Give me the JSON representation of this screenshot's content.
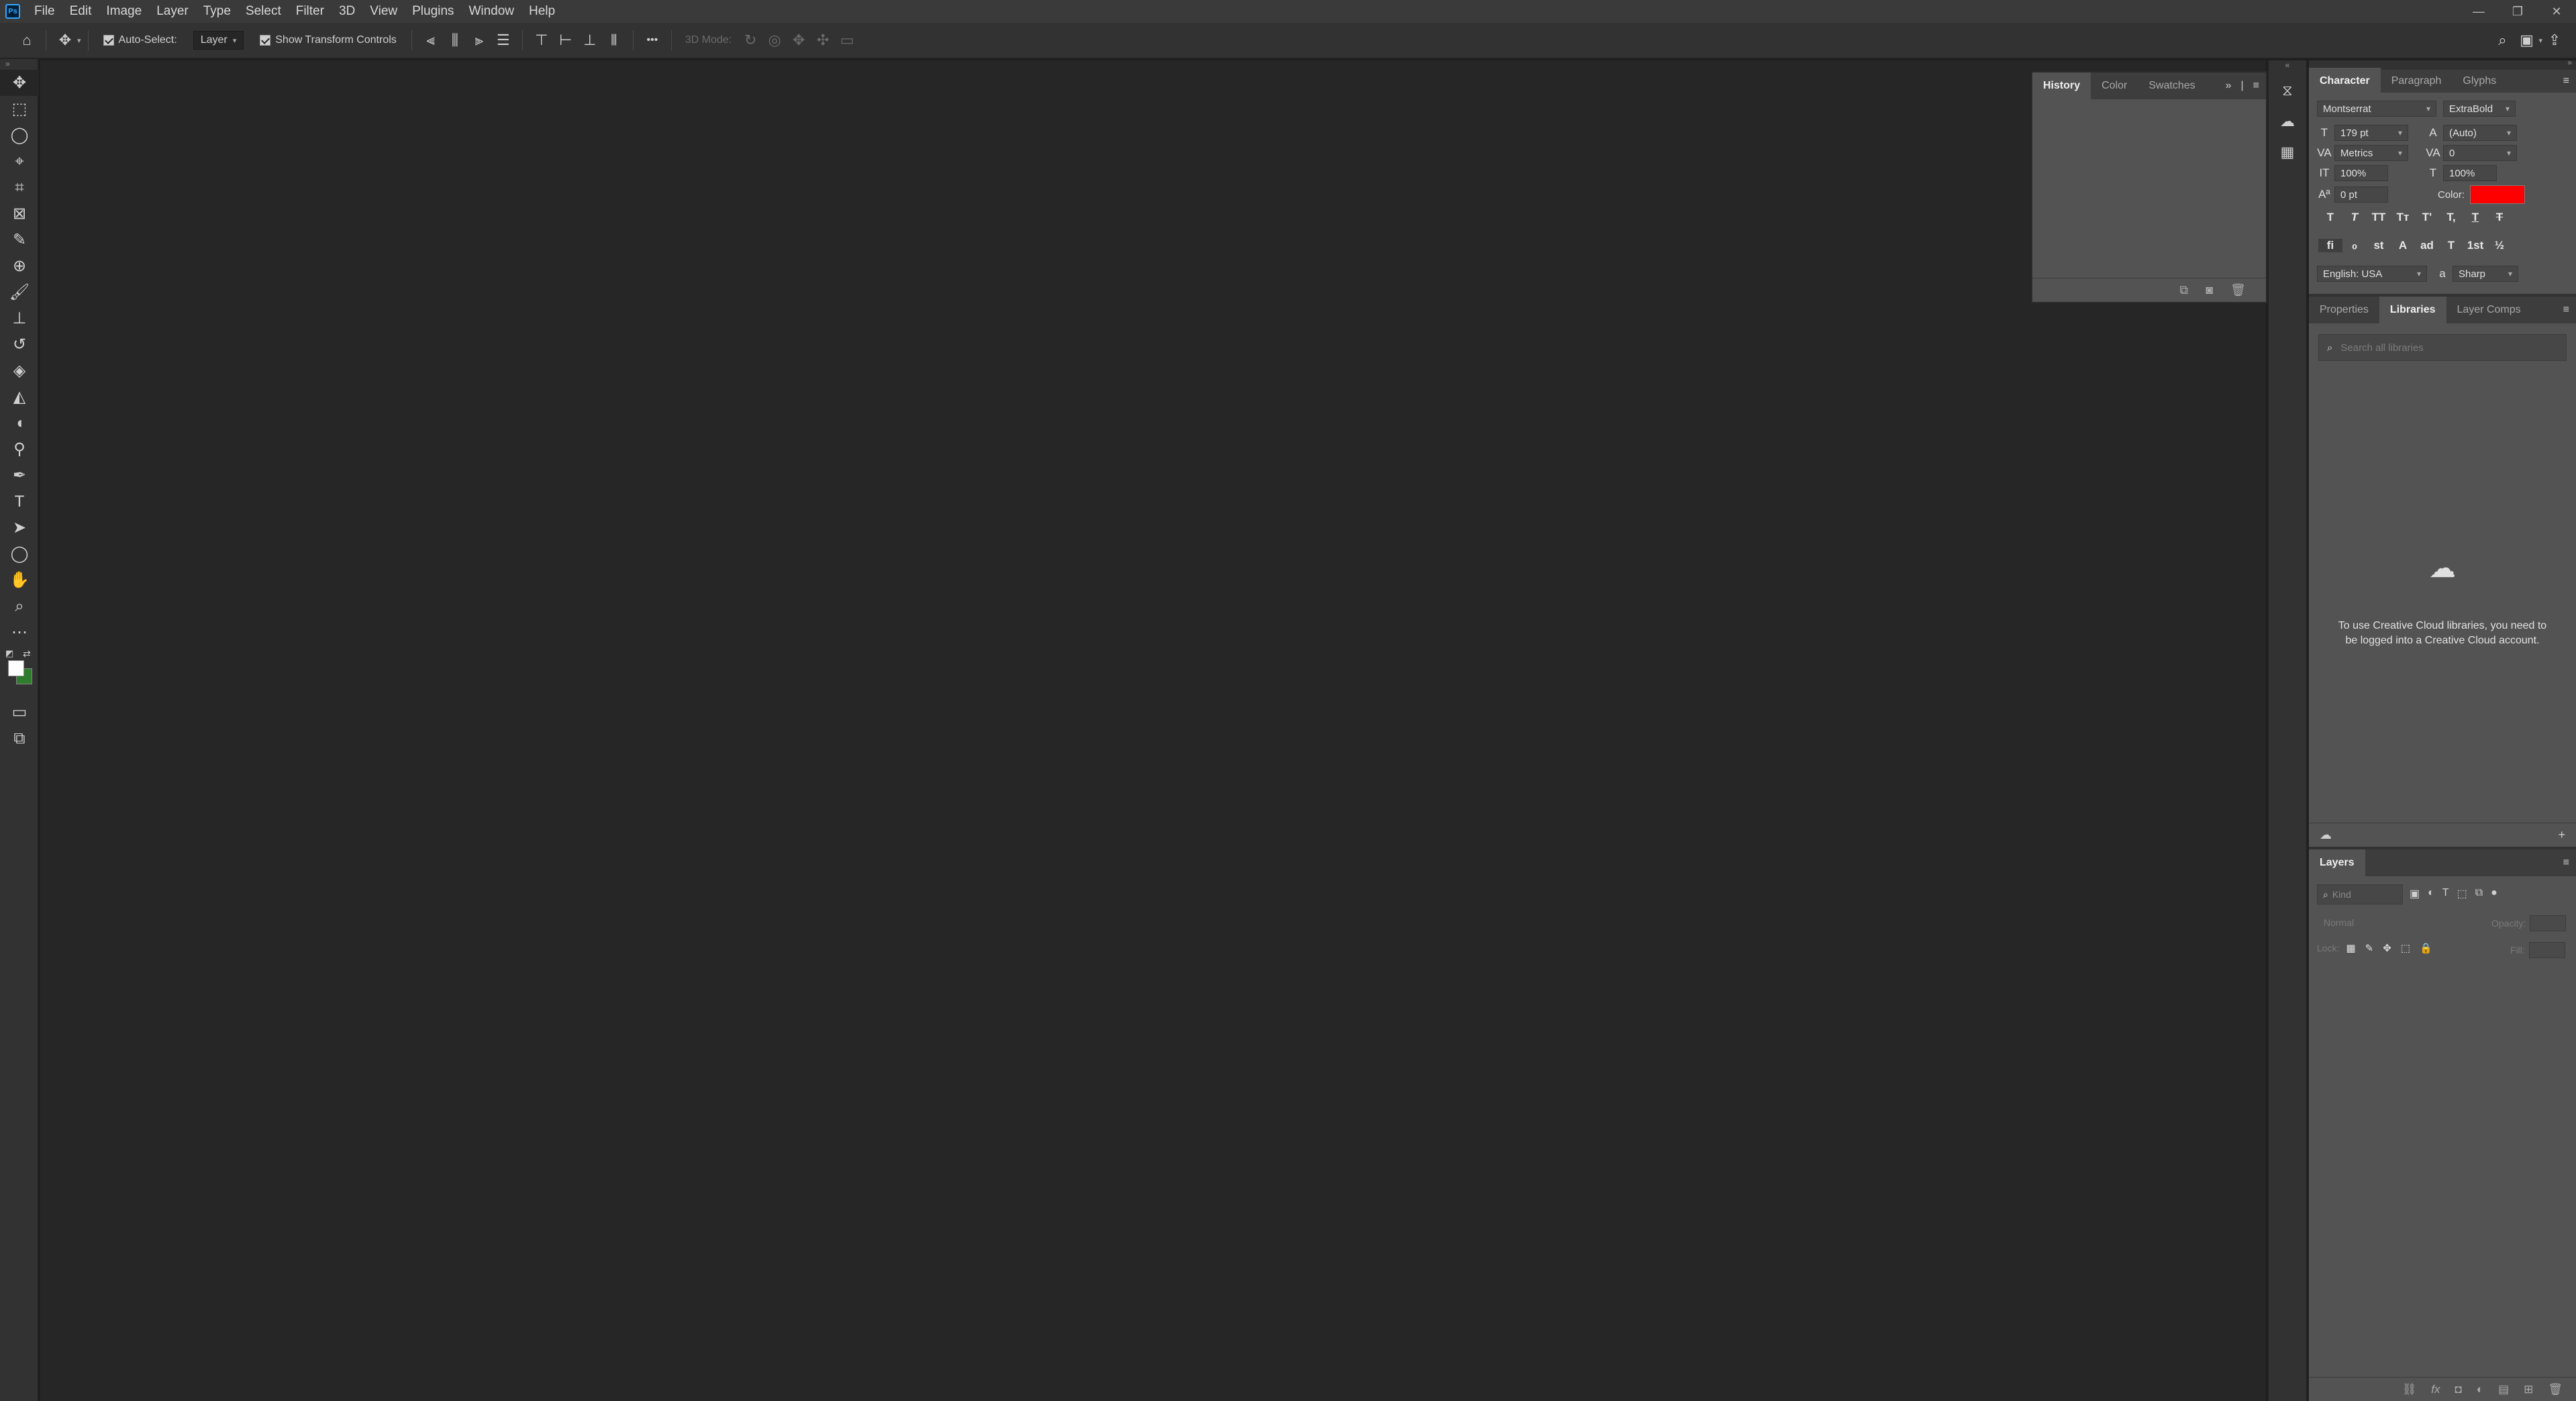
{
  "app": {
    "logo": "Ps"
  },
  "menu": [
    "File",
    "Edit",
    "Image",
    "Layer",
    "Type",
    "Select",
    "Filter",
    "3D",
    "View",
    "Plugins",
    "Window",
    "Help"
  ],
  "window_controls": [
    "—",
    "❐",
    "✕"
  ],
  "options_bar": {
    "auto_select_label": "Auto-Select:",
    "auto_select_target": "Layer",
    "transform_label": "Show Transform Controls",
    "more": "•••",
    "mode_3d_label": "3D Mode:"
  },
  "history_panel": {
    "tabs": [
      "History",
      "Color",
      "Swatches"
    ]
  },
  "character_panel": {
    "tabs": [
      "Character",
      "Paragraph",
      "Glyphs"
    ],
    "font_family": "Montserrat",
    "font_style": "ExtraBold",
    "font_size": "179 pt",
    "leading": "(Auto)",
    "kerning": "Metrics",
    "tracking": "0",
    "vertical_scale": "100%",
    "horizontal_scale": "100%",
    "baseline_shift": "0 pt",
    "color_label": "Color:",
    "color_value": "#ff0000",
    "language": "English: USA",
    "antialias_label": "a",
    "antialias": "Sharp",
    "type_styles": [
      "T",
      "T",
      "TT",
      "Tт",
      "T'",
      "T,",
      "T",
      "T"
    ],
    "opentype_features": [
      "fi",
      "ℴ",
      "st",
      "A",
      "ad",
      "T",
      "1st",
      "½"
    ]
  },
  "libraries_panel": {
    "tabs": [
      "Properties",
      "Libraries",
      "Layer Comps"
    ],
    "search_placeholder": "Search all libraries",
    "message": "To use Creative Cloud libraries, you need to be logged into a Creative Cloud account."
  },
  "layers_panel": {
    "title": "Layers",
    "filter_placeholder": "Kind",
    "blend_mode": "Normal",
    "opacity_label": "Opacity:",
    "lock_label": "Lock:",
    "fill_label": "Fill:"
  }
}
